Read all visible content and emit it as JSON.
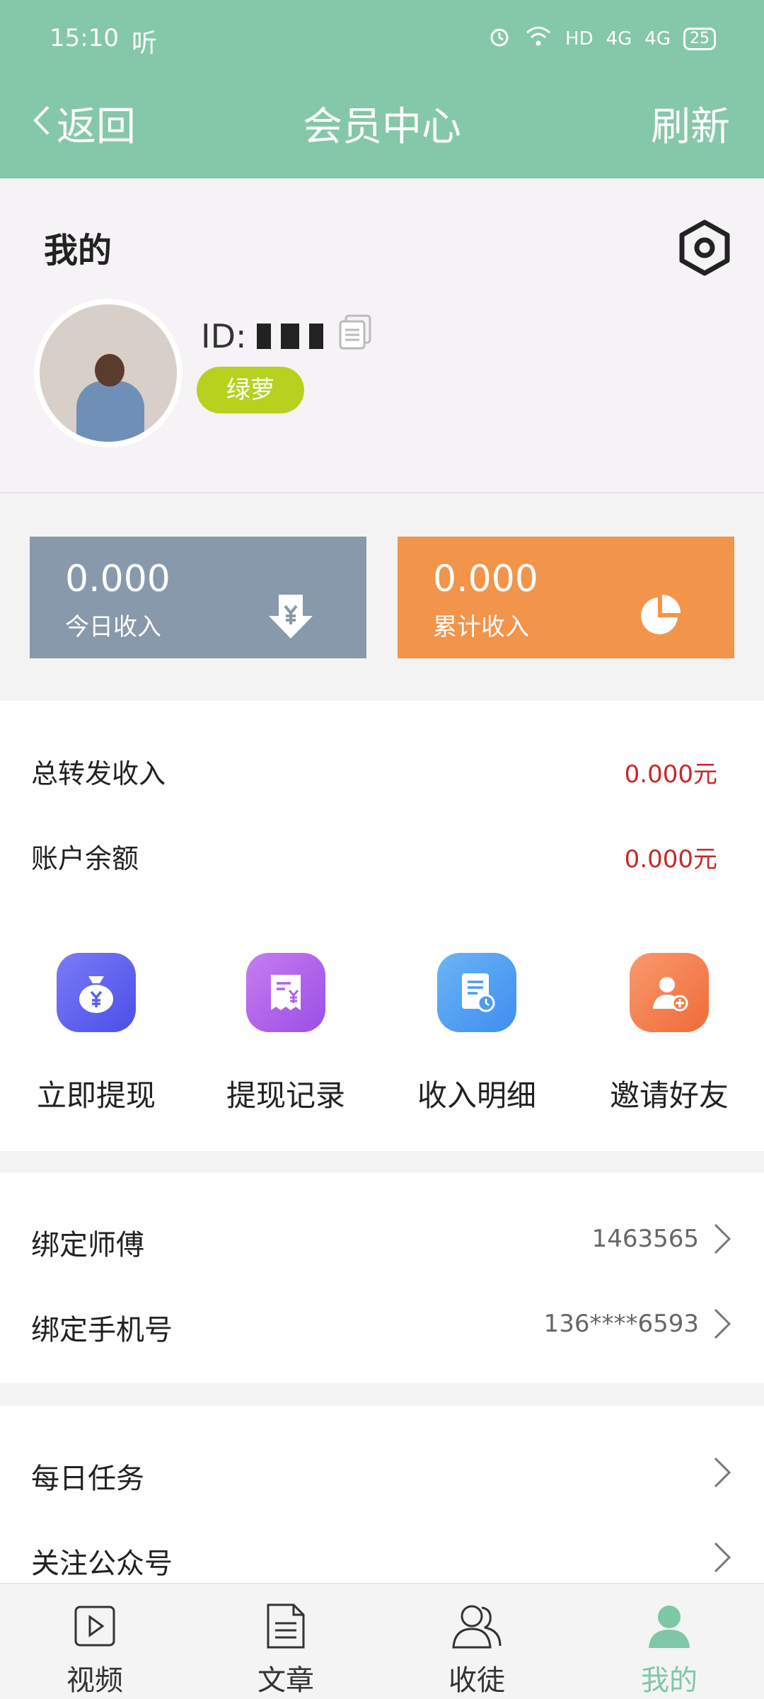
{
  "status_bar": {
    "time": "15:10",
    "extra": "听",
    "network": "HD",
    "signal1": "4G",
    "signal2": "4G",
    "battery": "25"
  },
  "nav": {
    "back_label": "返回",
    "title": "会员中心",
    "refresh_label": "刷新"
  },
  "profile": {
    "section_title": "我的",
    "user_id_prefix": "ID:",
    "level_badge": "绿萝"
  },
  "income_cards": {
    "today": {
      "value": "0.000",
      "label": "今日收入"
    },
    "total": {
      "value": "0.000",
      "label": "累计收入"
    }
  },
  "stats": [
    {
      "label": "总转发收入",
      "value": "0.000元"
    },
    {
      "label": "账户余额",
      "value": "0.000元"
    }
  ],
  "actions": [
    {
      "label": "立即提现",
      "icon": "money-bag-icon",
      "color": "#5b5ef0"
    },
    {
      "label": "提现记录",
      "icon": "receipt-icon",
      "color": "#b162ea"
    },
    {
      "label": "收入明细",
      "icon": "document-clock-icon",
      "color": "#4a9cf2"
    },
    {
      "label": "邀请好友",
      "icon": "add-user-icon",
      "color": "#f47c4e"
    }
  ],
  "bind": [
    {
      "label": "绑定师傅",
      "value": "1463565"
    },
    {
      "label": "绑定手机号",
      "value": "136****6593"
    }
  ],
  "tasks": [
    {
      "label": "每日任务"
    },
    {
      "label": "关注公众号"
    }
  ],
  "tabbar": [
    {
      "label": "视频",
      "icon": "video-play-icon"
    },
    {
      "label": "文章",
      "icon": "article-icon"
    },
    {
      "label": "收徒",
      "icon": "users-icon"
    },
    {
      "label": "我的",
      "icon": "person-icon",
      "active": true
    }
  ],
  "colors": {
    "header": "#85c8a9",
    "today_card": "#8799ab",
    "total_card": "#f2944a",
    "money": "#c62828",
    "badge": "#b6d21e",
    "active_tab": "#7ec8a6"
  }
}
